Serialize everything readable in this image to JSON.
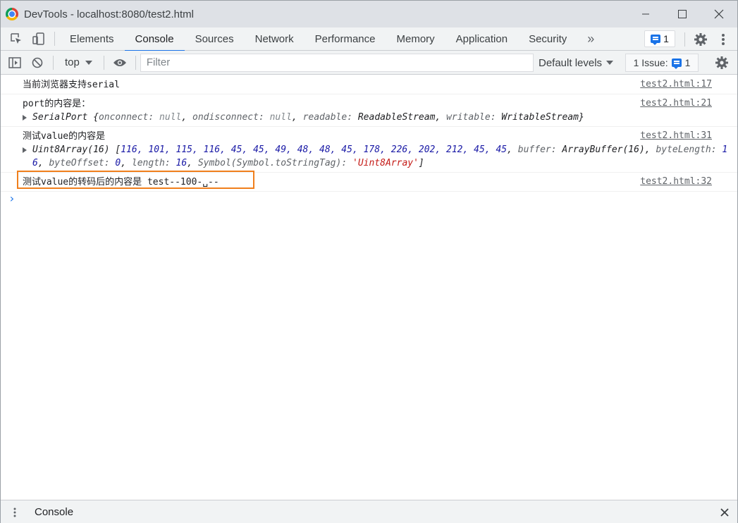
{
  "window": {
    "title": "DevTools - localhost:8080/test2.html"
  },
  "tabs": [
    "Elements",
    "Console",
    "Sources",
    "Network",
    "Performance",
    "Memory",
    "Application",
    "Security"
  ],
  "active_tab": "Console",
  "tabbar": {
    "more": "»",
    "messages_count": "1"
  },
  "toolbar": {
    "context": "top",
    "filter_placeholder": "Filter",
    "levels": "Default levels",
    "issues_label": "1 Issue:",
    "issues_count": "1"
  },
  "console": {
    "messages": [
      {
        "text": "当前浏览器支持serial",
        "source": "test2.html:17"
      },
      {
        "text": "port的内容是：",
        "source": "test2.html:21"
      },
      {
        "text": "测试value的内容是",
        "source": "test2.html:31"
      },
      {
        "text": "测试value的转码后的内容是 test--100-␣--",
        "source": "test2.html:32"
      }
    ],
    "serialport": {
      "type": "SerialPort",
      "onconnect_key": "onconnect",
      "onconnect_val": "null",
      "ondisconnect_key": "ondisconnect",
      "ondisconnect_val": "null",
      "readable_key": "readable",
      "readable_val": "ReadableStream",
      "writable_key": "writable",
      "writable_val": "WritableStream"
    },
    "uint8array": {
      "type": "Uint8Array(16)",
      "values": "116, 101, 115, 116, 45, 45, 49, 48, 48, 45, 178, 226, 202, 212, 45, 45",
      "buffer_key": "buffer",
      "buffer_val": "ArrayBuffer(16)",
      "bytelength_key": "byteLength",
      "bytelength_val": "16",
      "byteoffset_key": "byteOffset",
      "byteoffset_val": "0",
      "length_key": "length",
      "length_val": "16",
      "symbol_key": "Symbol(Symbol.toStringTag)",
      "symbol_val": "'Uint8Array'"
    },
    "prompt": "›"
  },
  "drawer": {
    "tab": "Console"
  }
}
